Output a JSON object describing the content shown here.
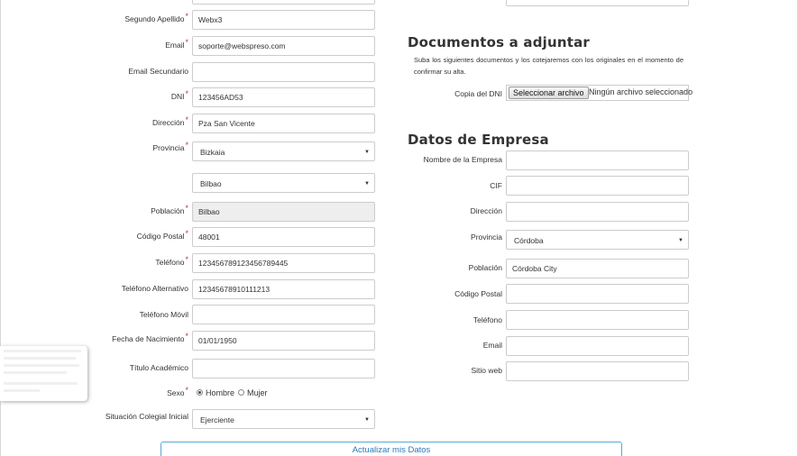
{
  "left_form": {
    "segundo_apellido": {
      "label": "Segundo Apellido",
      "value": "Webx3",
      "required": "*"
    },
    "email": {
      "label": "Email",
      "value": "soporte@webspreso.com",
      "required": "*"
    },
    "email_secundario": {
      "label": "Email Secundario",
      "value": ""
    },
    "dni": {
      "label": "DNI",
      "value": "123456AD53",
      "required": "*"
    },
    "direccion": {
      "label": "Dirección",
      "value": "Pza San Vicente",
      "required": "*"
    },
    "provincia": {
      "label": "Provincia",
      "value": "Bizkaia",
      "required": "*"
    },
    "municipio": {
      "value": "Bilbao"
    },
    "poblacion": {
      "label": "Población",
      "value": "Bilbao",
      "required": "*"
    },
    "codigo_postal": {
      "label": "Código Postal",
      "value": "48001",
      "required": "*"
    },
    "telefono": {
      "label": "Teléfono",
      "value": "123456789123456789445",
      "required": "*"
    },
    "telefono_alternativo": {
      "label": "Teléfono Alternativo",
      "value": "12345678910111213"
    },
    "telefono_movil": {
      "label": "Teléfono Móvil",
      "value": ""
    },
    "fecha_nacimiento": {
      "label": "Fecha de Nacimiento",
      "value": "01/01/1950",
      "required": "*"
    },
    "titulo_academico": {
      "label": "Título Académico",
      "value": ""
    },
    "sexo": {
      "label": "Sexo",
      "required": "*",
      "options": [
        "Hombre",
        "Mujer"
      ],
      "selected": "Hombre"
    },
    "situacion_colegial": {
      "label": "Situación Colegial Inicial",
      "value": "Ejerciente"
    }
  },
  "documentos": {
    "title": "Documentos a adjuntar",
    "description": "Suba los siguientes documentos y los cotejaremos con los originales en el momento de confirmar su alta.",
    "copia_dni": {
      "label": "Copia del DNI",
      "button": "Seleccionar archivo",
      "status": "Ningún archivo seleccionado"
    }
  },
  "empresa": {
    "title": "Datos de Empresa",
    "nombre": {
      "label": "Nombre de la Empresa",
      "value": ""
    },
    "cif": {
      "label": "CIF",
      "value": ""
    },
    "direccion": {
      "label": "Dirección",
      "value": ""
    },
    "provincia": {
      "label": "Provincia",
      "value": "Córdoba"
    },
    "poblacion": {
      "label": "Población",
      "value": "Córdoba City"
    },
    "codigo_postal": {
      "label": "Código Postal",
      "value": ""
    },
    "telefono": {
      "label": "Teléfono",
      "value": ""
    },
    "email": {
      "label": "Email",
      "value": ""
    },
    "sitio_web": {
      "label": "Sitio web",
      "value": ""
    }
  },
  "submit_label": "Actualizar mis Datos",
  "icons": {
    "select_arrow": "▼"
  },
  "colors": {
    "required": "#c0392b",
    "button_border": "#5aa7d6",
    "button_text": "#2a7ab8",
    "disabled_bg": "#eeeeee"
  }
}
